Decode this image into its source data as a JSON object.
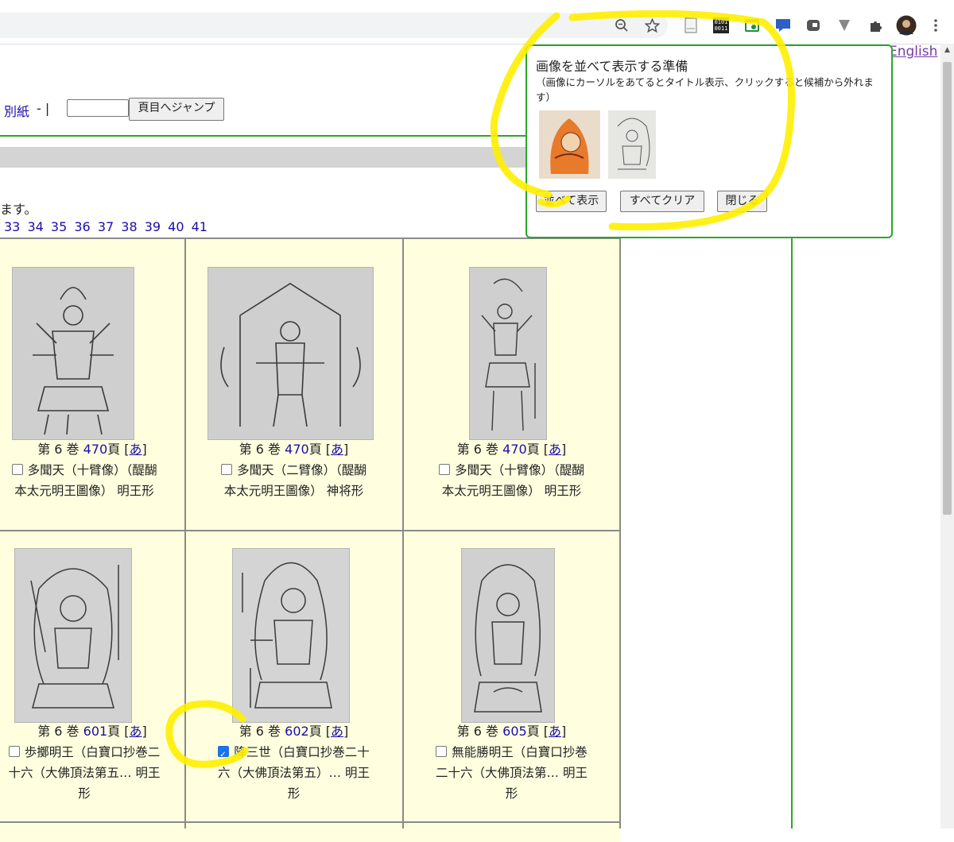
{
  "toolbar": {
    "icons": [
      "zoom-icon",
      "star-icon",
      "document-icon",
      "binary-icon",
      "screenshot-icon",
      "chat-icon",
      "cursor-icon",
      "vivaldi-icon",
      "extensions-icon",
      "profile-avatar",
      "menu-icon"
    ],
    "binary_text": "0101\n0011"
  },
  "header": {
    "english_link": "English",
    "separate_link": "別紙",
    "separator": "- |",
    "jump_button": "頁目へジャンプ"
  },
  "notice_tail": "ます。",
  "page_numbers": [
    "33",
    "34",
    "35",
    "36",
    "37",
    "38",
    "39",
    "40",
    "41"
  ],
  "cells": [
    {
      "vol": "第 6 巻",
      "page": "470",
      "page_suffix": "頁",
      "kana": "あ",
      "checked": false,
      "line1": "多聞天（十臂像）（醍醐",
      "line2": "本太元明王圖像） 明王形",
      "line3": ""
    },
    {
      "vol": "第 6 巻",
      "page": "470",
      "page_suffix": "頁",
      "kana": "あ",
      "checked": false,
      "line1": "多聞天（二臂像）（醍醐",
      "line2": "本太元明王圖像） 神将形",
      "line3": ""
    },
    {
      "vol": "第 6 巻",
      "page": "470",
      "page_suffix": "頁",
      "kana": "あ",
      "checked": false,
      "line1": "多聞天（十臂像）（醍醐",
      "line2": "本太元明王圖像） 明王形",
      "line3": ""
    },
    {
      "vol": "第 6 巻",
      "page": "601",
      "page_suffix": "頁",
      "kana": "あ",
      "checked": false,
      "line1": "歩擲明王（白寶口抄巻二",
      "line2": "十六（大佛頂法第五… 明王",
      "line3": "形"
    },
    {
      "vol": "第 6 巻",
      "page": "602",
      "page_suffix": "頁",
      "kana": "あ",
      "checked": true,
      "line1": "降三世（白寶口抄巻二十",
      "line2": "六（大佛頂法第五）… 明王",
      "line3": "形"
    },
    {
      "vol": "第 6 巻",
      "page": "605",
      "page_suffix": "頁",
      "kana": "あ",
      "checked": false,
      "line1": "無能勝明王（白寶口抄巻",
      "line2": "二十六（大佛頂法第… 明王",
      "line3": "形"
    }
  ],
  "panel": {
    "title": "画像を並べて表示する準備",
    "note": "（画像にカーソルをあてるとタイトル表示、クリックすると候補から外れます）",
    "show_button": "並べて表示",
    "clear_button": "すべてクリア",
    "close_button": "閉じる"
  },
  "colors": {
    "accent_green": "#2aa82a",
    "highlight_yellow": "#ffee00",
    "cell_bg": "#ffffe0",
    "link": "#1a0dab"
  }
}
